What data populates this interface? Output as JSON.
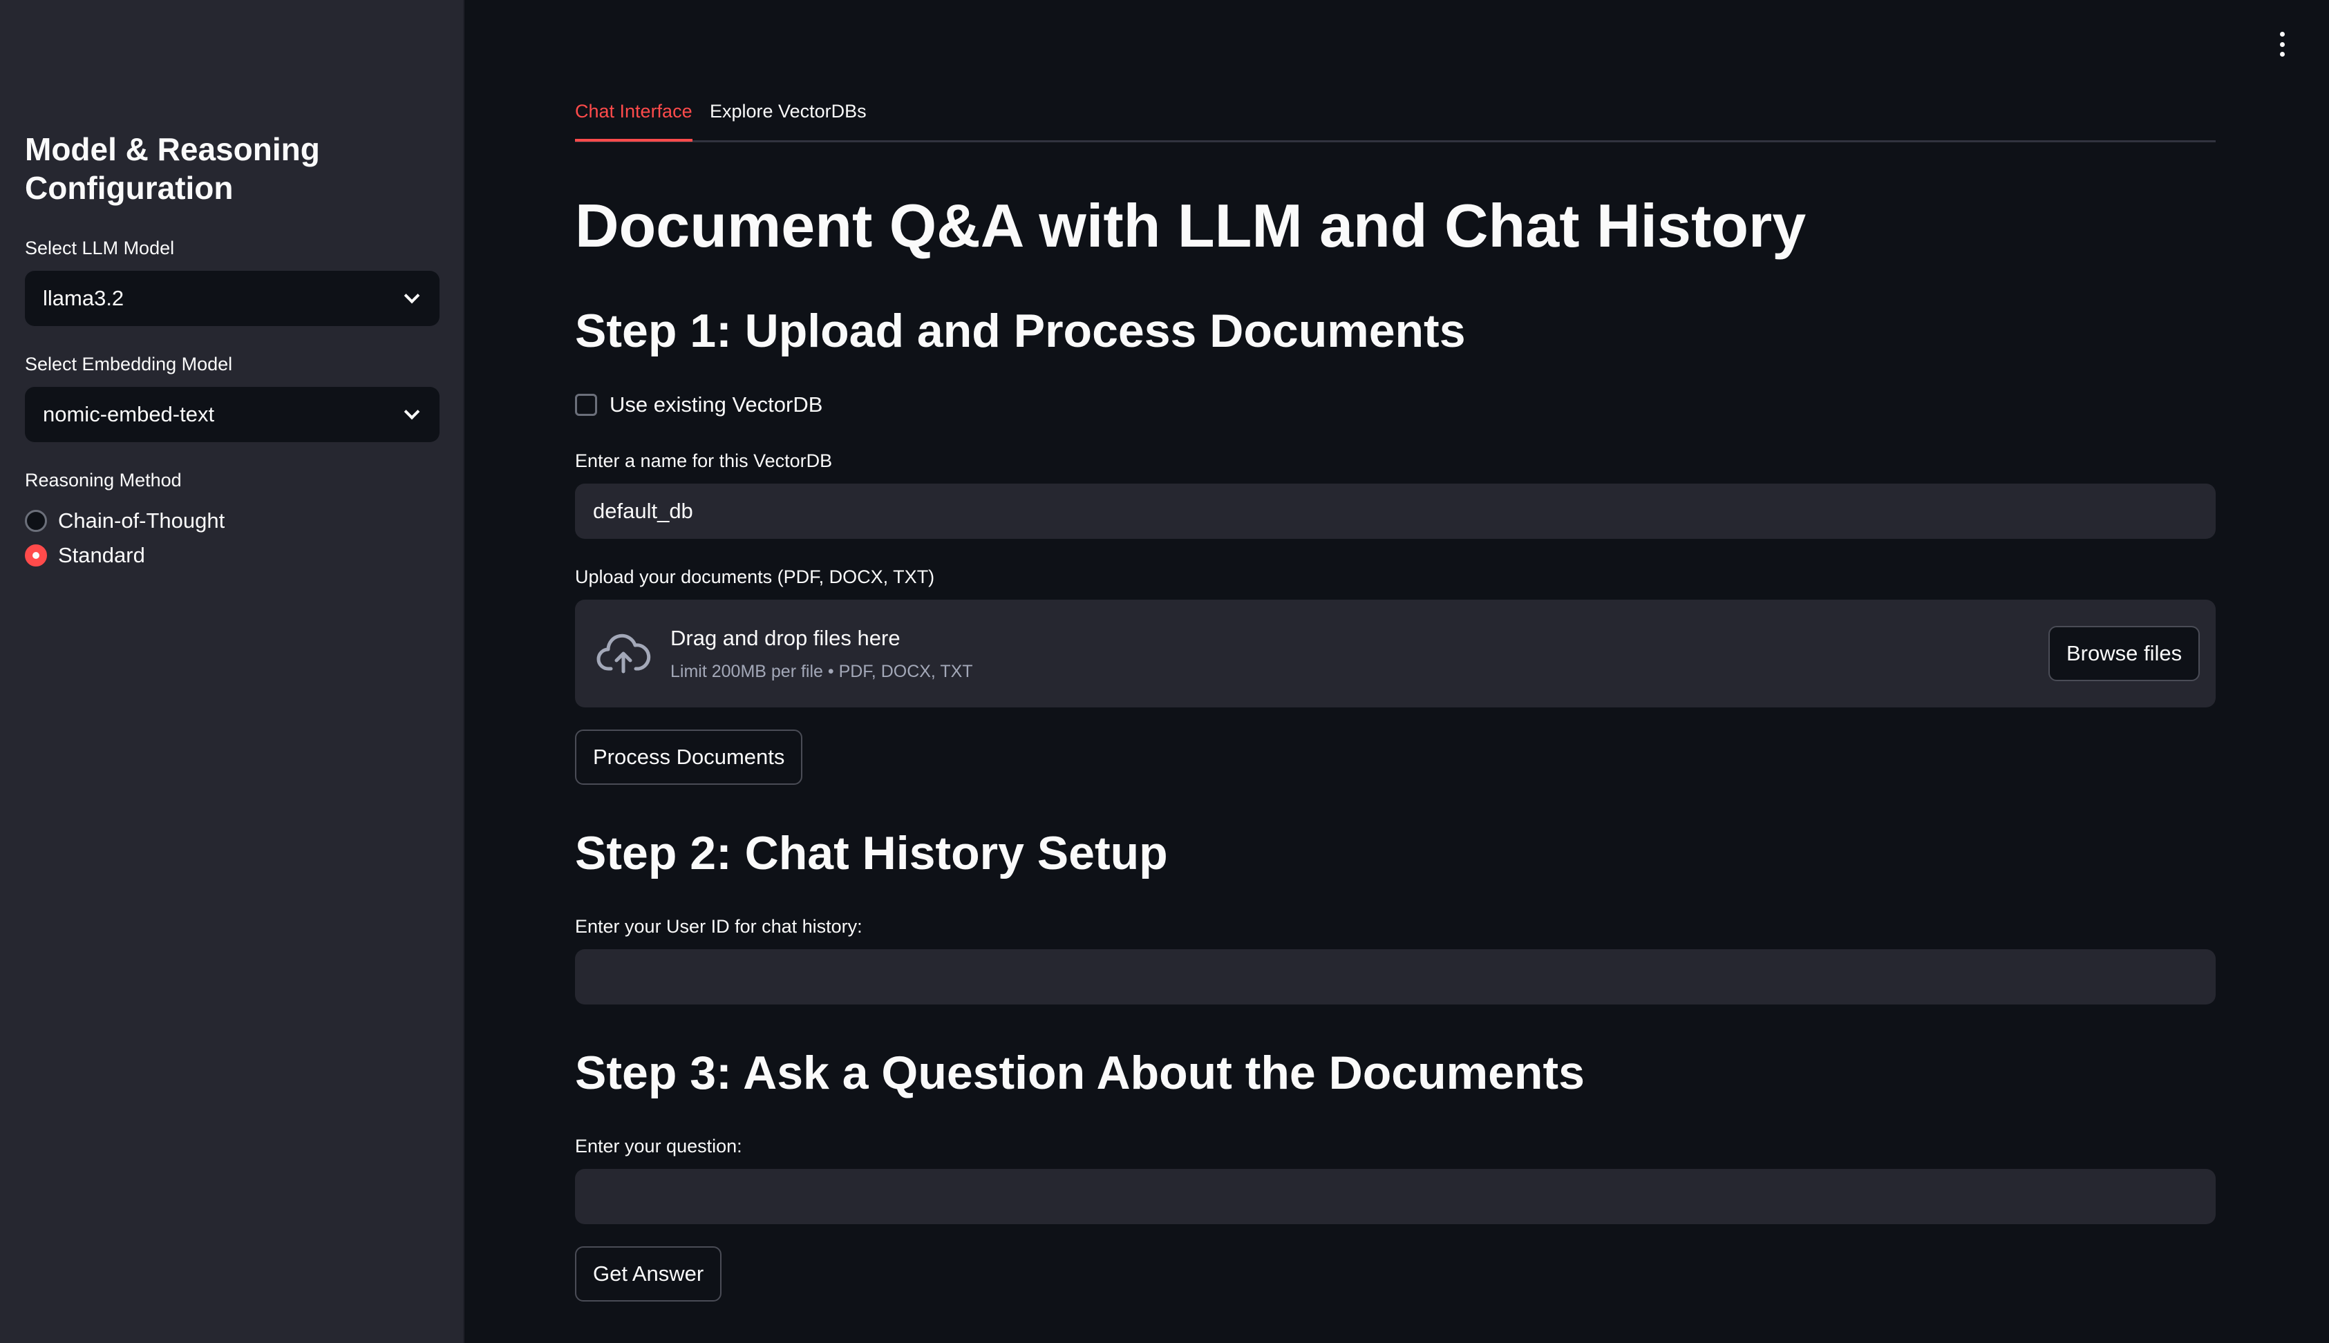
{
  "sidebar": {
    "title": "Model & Reasoning Configuration",
    "llm_label": "Select LLM Model",
    "llm_value": "llama3.2",
    "embedding_label": "Select Embedding Model",
    "embedding_value": "nomic-embed-text",
    "reasoning_label": "Reasoning Method",
    "reasoning_options": [
      {
        "label": "Chain-of-Thought",
        "selected": false
      },
      {
        "label": "Standard",
        "selected": true
      }
    ]
  },
  "tabs": [
    {
      "label": "Chat Interface",
      "active": true
    },
    {
      "label": "Explore VectorDBs",
      "active": false
    }
  ],
  "main": {
    "title": "Document Q&A with LLM and Chat History",
    "step1": {
      "heading": "Step 1: Upload and Process Documents",
      "use_existing_label": "Use existing VectorDB",
      "db_name_label": "Enter a name for this VectorDB",
      "db_name_value": "default_db",
      "upload_label": "Upload your documents (PDF, DOCX, TXT)",
      "upload_main": "Drag and drop files here",
      "upload_sub": "Limit 200MB per file • PDF, DOCX, TXT",
      "browse_button": "Browse files",
      "process_button": "Process Documents"
    },
    "step2": {
      "heading": "Step 2: Chat History Setup",
      "user_id_label": "Enter your User ID for chat history:",
      "user_id_value": ""
    },
    "step3": {
      "heading": "Step 3: Ask a Question About the Documents",
      "question_label": "Enter your question:",
      "question_value": "",
      "answer_button": "Get Answer"
    }
  },
  "colors": {
    "background": "#0e1117",
    "sidebar": "#262730",
    "accent": "#ff4b4b"
  },
  "icons": [
    "chevron-down-icon",
    "upload-cloud-icon",
    "more-vertical-icon"
  ]
}
